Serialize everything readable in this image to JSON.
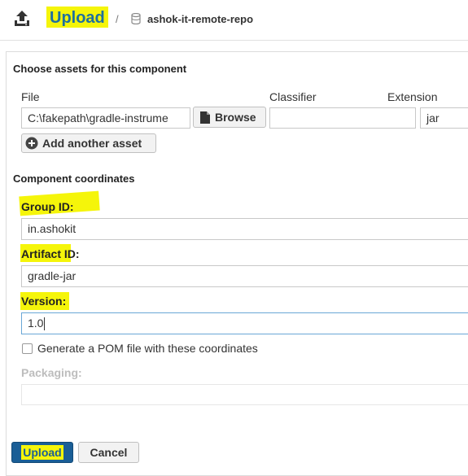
{
  "header": {
    "title": "Upload",
    "separator": "/",
    "repository": "ashok-it-remote-repo",
    "icons": {
      "upload": "upload-icon",
      "repository": "database-icon"
    }
  },
  "assets": {
    "heading": "Choose assets for this component",
    "columns": {
      "file": "File",
      "classifier": "Classifier",
      "extension": "Extension"
    },
    "file_value": "C:\\fakepath\\gradle-instrume",
    "browse_label": "Browse",
    "classifier_value": "",
    "extension_value": "jar",
    "add_asset_label": "Add another asset"
  },
  "coordinates": {
    "heading": "Component coordinates",
    "group_id_label": "Group ID:",
    "group_id_value": "in.ashokit",
    "artifact_id_label": "Artifact ID:",
    "artifact_id_value": "gradle-jar",
    "version_label": "Version:",
    "version_value": "1.0",
    "generate_pom_label": "Generate a POM file with these coordinates",
    "generate_pom_checked": false,
    "packaging_label": "Packaging:",
    "packaging_value": ""
  },
  "actions": {
    "upload_label": "Upload",
    "cancel_label": "Cancel"
  },
  "colors": {
    "highlight": "#f5f50a",
    "title_blue": "#1e6fa0",
    "upload_button": "#1a5e96",
    "focus_border": "#6aa7d6"
  }
}
